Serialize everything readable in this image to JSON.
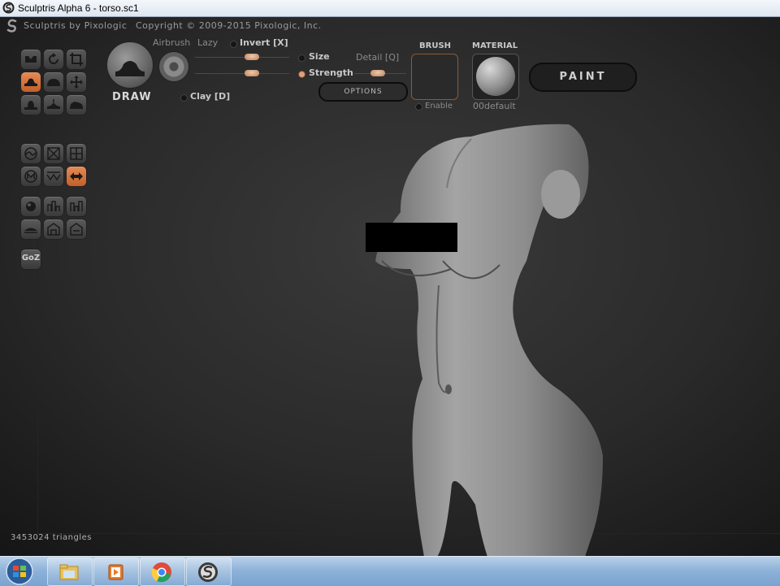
{
  "window": {
    "title": "Sculptris Alpha 6 - torso.sc1"
  },
  "header": {
    "app_name": "Sculptris by Pixologic",
    "copyright": "Copyright © 2009-2015 Pixologic, Inc."
  },
  "toolbar": {
    "brush_name": "DRAW",
    "airbrush_label": "Airbrush",
    "lazy_label": "Lazy",
    "invert_label": "Invert [X]",
    "clay_label": "Clay [D]",
    "size_label": "Size",
    "strength_label": "Strength",
    "detail_label": "Detail [Q]",
    "options_label": "OPTIONS",
    "size_value": 0.6,
    "strength_value": 0.6,
    "detail_value": 0.45,
    "brush_panel": {
      "title": "BRUSH",
      "enable_label": "Enable"
    },
    "material_panel": {
      "title": "MATERIAL",
      "name": "00default"
    },
    "paint_label": "PAINT"
  },
  "tools": [
    {
      "name": "crease-tool",
      "active": false
    },
    {
      "name": "rotate-tool",
      "active": false
    },
    {
      "name": "scale-tool",
      "active": false
    },
    {
      "name": "draw-tool",
      "active": true
    },
    {
      "name": "inflate-tool",
      "active": false
    },
    {
      "name": "grab-tool",
      "active": false
    },
    {
      "name": "flatten-tool",
      "active": false
    },
    {
      "name": "pinch-tool",
      "active": false
    },
    {
      "name": "smooth-tool",
      "active": false
    },
    {
      "name": "symmetry-tool",
      "active": false
    },
    {
      "name": "wireframe-tool",
      "active": false
    },
    {
      "name": "grid-tool",
      "active": false
    },
    {
      "name": "mask-tool",
      "active": false
    },
    {
      "name": "reduce-tool",
      "active": false
    },
    {
      "name": "mirror-tool",
      "active": true
    },
    {
      "name": "sphere-tool",
      "active": false
    },
    {
      "name": "subdivide-tool",
      "active": false
    },
    {
      "name": "reduce-selected-tool",
      "active": false
    },
    {
      "name": "plane-tool",
      "active": false
    },
    {
      "name": "hide-tool",
      "active": false
    },
    {
      "name": "show-tool",
      "active": false
    }
  ],
  "goz_label": "GoZ",
  "status": {
    "triangles": "3453024 triangles"
  },
  "colors": {
    "accent": "#d9703d",
    "slider_knob": "#e0b090",
    "viewport_bg": "#2b2b2b",
    "taskbar": "#9dbde0"
  },
  "taskbar": {
    "items": [
      {
        "icon": "windows-start-icon"
      },
      {
        "icon": "file-explorer-icon"
      },
      {
        "icon": "media-player-icon"
      },
      {
        "icon": "chrome-icon"
      },
      {
        "icon": "sculptris-icon"
      }
    ]
  }
}
